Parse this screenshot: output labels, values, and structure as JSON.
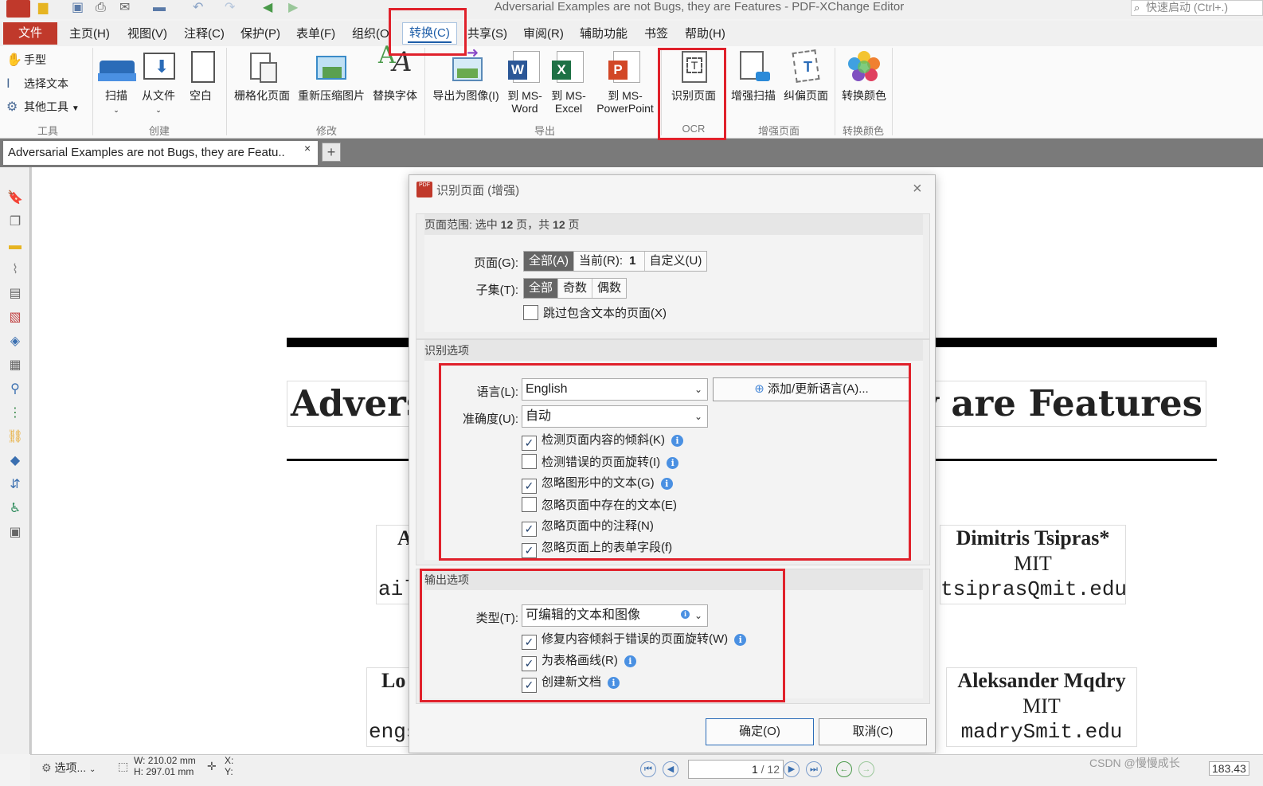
{
  "window": {
    "title": "Adversarial Examples are not Bugs, they are Features - PDF-XChange Editor",
    "quick_launch": "快速启动 (Ctrl+.)"
  },
  "menu": {
    "file": "文件",
    "items": [
      "主页(H)",
      "视图(V)",
      "注释(C)",
      "保护(P)",
      "表单(F)",
      "组织(O",
      "转换(C)",
      "共享(S)",
      "审阅(R)",
      "辅助功能",
      "书签",
      "帮助(H)"
    ]
  },
  "ribbon": {
    "tools": {
      "hand": "手型",
      "select_text": "选择文本",
      "other_tools": "其他工具",
      "group": "工具"
    },
    "create": {
      "scan": "扫描",
      "from_file": "从文件",
      "blank": "空白",
      "group": "创建"
    },
    "modify": {
      "rasterize_line1": "栅格化页面",
      "recompress": "重新压缩图片",
      "replace_fonts": "替换字体",
      "group": "修改"
    },
    "export": {
      "to_image": "导出为图像(I)",
      "word_l1": "到 MS-",
      "word_l2": "Word",
      "excel_l1": "到 MS-",
      "excel_l2": "Excel",
      "ppt_l1": "到 MS-",
      "ppt_l2": "PowerPoint",
      "group": "导出"
    },
    "ocr": {
      "recognize": "识别页面",
      "group": "OCR"
    },
    "enhance": {
      "enhance_scan": "增强扫描",
      "deskew": "纠偏页面",
      "group": "增强页面"
    },
    "colors": {
      "convert": "转换颜色",
      "group": "转换颜色"
    }
  },
  "tab": {
    "label": "Adversarial Examples are not Bugs, they are Featu..",
    "close": "×",
    "new": "+"
  },
  "document": {
    "title_left": "Adversa",
    "title_right": "hey are Features",
    "author1": {
      "name": "A",
      "mail": "aily"
    },
    "author2": {
      "name": "Dimitris Tsipras*",
      "aff": "MIT",
      "mail": "tsiprasQmit.edu"
    },
    "author3": {
      "name": "Lo",
      "mail": "engs"
    },
    "author4": {
      "name": "Aleksander Mqdry",
      "aff": "MIT",
      "mail": "madrySmit.edu"
    }
  },
  "dialog": {
    "title": "识别页面 (增强)",
    "close": "×",
    "range": {
      "head_prefix": "页面范围: 选中 ",
      "head_selected": "12",
      "head_mid": " 页，共 ",
      "head_total": "12",
      "head_suffix": " 页",
      "pages_label": "页面(G):",
      "pages_all": "全部(A)",
      "pages_current": "当前(R):",
      "current_value": "1",
      "pages_custom": "自定义(U)",
      "subset_label": "子集(T):",
      "subset_all": "全部",
      "subset_odd": "奇数",
      "subset_even": "偶数",
      "skip_text_pages": "跳过包含文本的页面(X)",
      "skip_text_pages_checked": false
    },
    "recog": {
      "head": "识别选项",
      "language_label": "语言(L):",
      "language_value": "English",
      "add_lang_button": "添加/更新语言(A)...",
      "accuracy_label": "准确度(U):",
      "accuracy_value": "自动",
      "options": [
        {
          "label": "检测页面内容的倾斜(K)",
          "checked": true,
          "info": true
        },
        {
          "label": "检测错误的页面旋转(I)",
          "checked": false,
          "info": true
        },
        {
          "label": "忽略图形中的文本(G)",
          "checked": true,
          "info": true
        },
        {
          "label": "忽略页面中存在的文本(E)",
          "checked": false,
          "info": false
        },
        {
          "label": "忽略页面中的注释(N)",
          "checked": true,
          "info": false
        },
        {
          "label": "忽略页面上的表单字段(f)",
          "checked": true,
          "info": false
        }
      ]
    },
    "output": {
      "head": "输出选项",
      "type_label": "类型(T):",
      "type_value": "可编辑的文本和图像",
      "options": [
        {
          "label": "修复内容倾斜于错误的页面旋转(W)",
          "checked": true,
          "info": true
        },
        {
          "label": "为表格画线(R)",
          "checked": true,
          "info": true
        },
        {
          "label": "创建新文档",
          "checked": true,
          "info": true
        }
      ]
    },
    "ok": "确定(O)",
    "cancel": "取消(C)"
  },
  "status": {
    "options": "选项...",
    "width": "W: 210.02 mm",
    "height": "H: 297.01 mm",
    "x": "X:",
    "y": "Y:",
    "page_current": "1",
    "page_total": "/ 12",
    "zoom": "183.43",
    "watermark": "CSDN @慢慢成长"
  },
  "colors": {
    "accent": "#1d5da8",
    "file_button": "#c0392b",
    "annotation_red": "#e0212b",
    "info_blue": "#4a90e2"
  }
}
